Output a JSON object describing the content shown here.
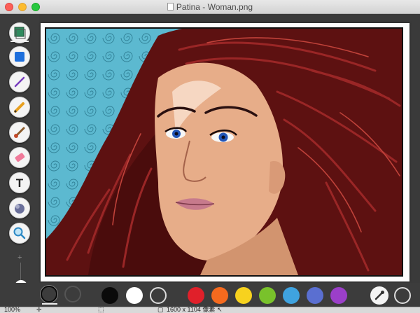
{
  "window": {
    "title": "Patina - Woman.png"
  },
  "toolbar": {
    "tools": [
      {
        "name": "layers-icon"
      },
      {
        "name": "rectangle-icon"
      },
      {
        "name": "line-icon"
      },
      {
        "name": "pencil-icon"
      },
      {
        "name": "brush-icon"
      },
      {
        "name": "eraser-icon"
      },
      {
        "name": "text-icon",
        "glyph": "T"
      },
      {
        "name": "fill-icon"
      },
      {
        "name": "zoom-icon"
      }
    ],
    "zoom_plus": "+",
    "zoom_minus": "−"
  },
  "palette": {
    "colors": [
      "#0a0a0a",
      "#ffffff",
      "#e0202a",
      "#f56a1e",
      "#f7d21e",
      "#79c22b",
      "#3fa3e0",
      "#5a6fd1",
      "#9b3fc9"
    ],
    "selected_stroke": "#0a0a0a"
  },
  "status": {
    "zoom": "100%",
    "dimensions": "1600 x 1104 像素"
  },
  "colors": {
    "hair": "#6d1515",
    "hair_dark": "#3b0b0b",
    "background": "#5ab8cf",
    "skin": "#e9b08b"
  }
}
